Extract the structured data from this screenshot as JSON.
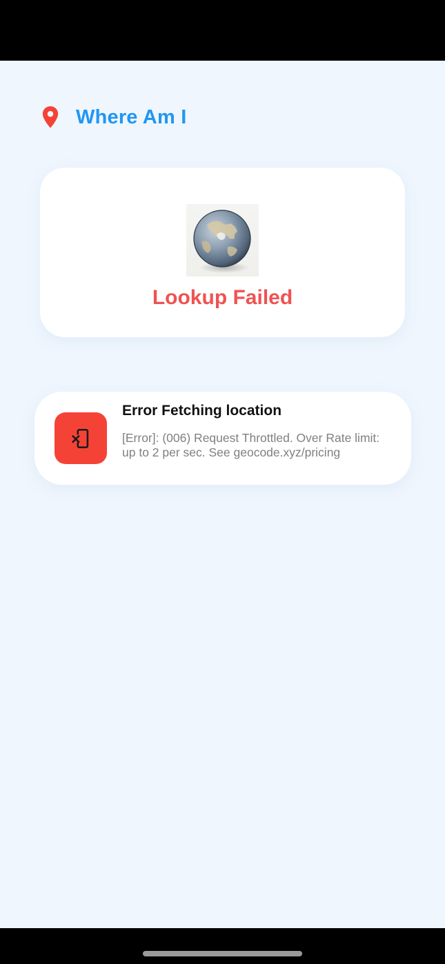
{
  "app": {
    "title": "Where Am I",
    "accent_color": "#2196f3",
    "pin_icon": "location-pin-icon",
    "pin_color": "#f44336"
  },
  "status_card": {
    "image": "globe-image",
    "title": "Lookup Failed",
    "title_color": "#f05252"
  },
  "error": {
    "icon": "phone-error-icon",
    "icon_bg": "#f44336",
    "title": "Error Fetching location",
    "message": "[Error]: (006) Request Throttled. Over Rate limit: up to 2 per sec. See geocode.xyz/pricing"
  }
}
